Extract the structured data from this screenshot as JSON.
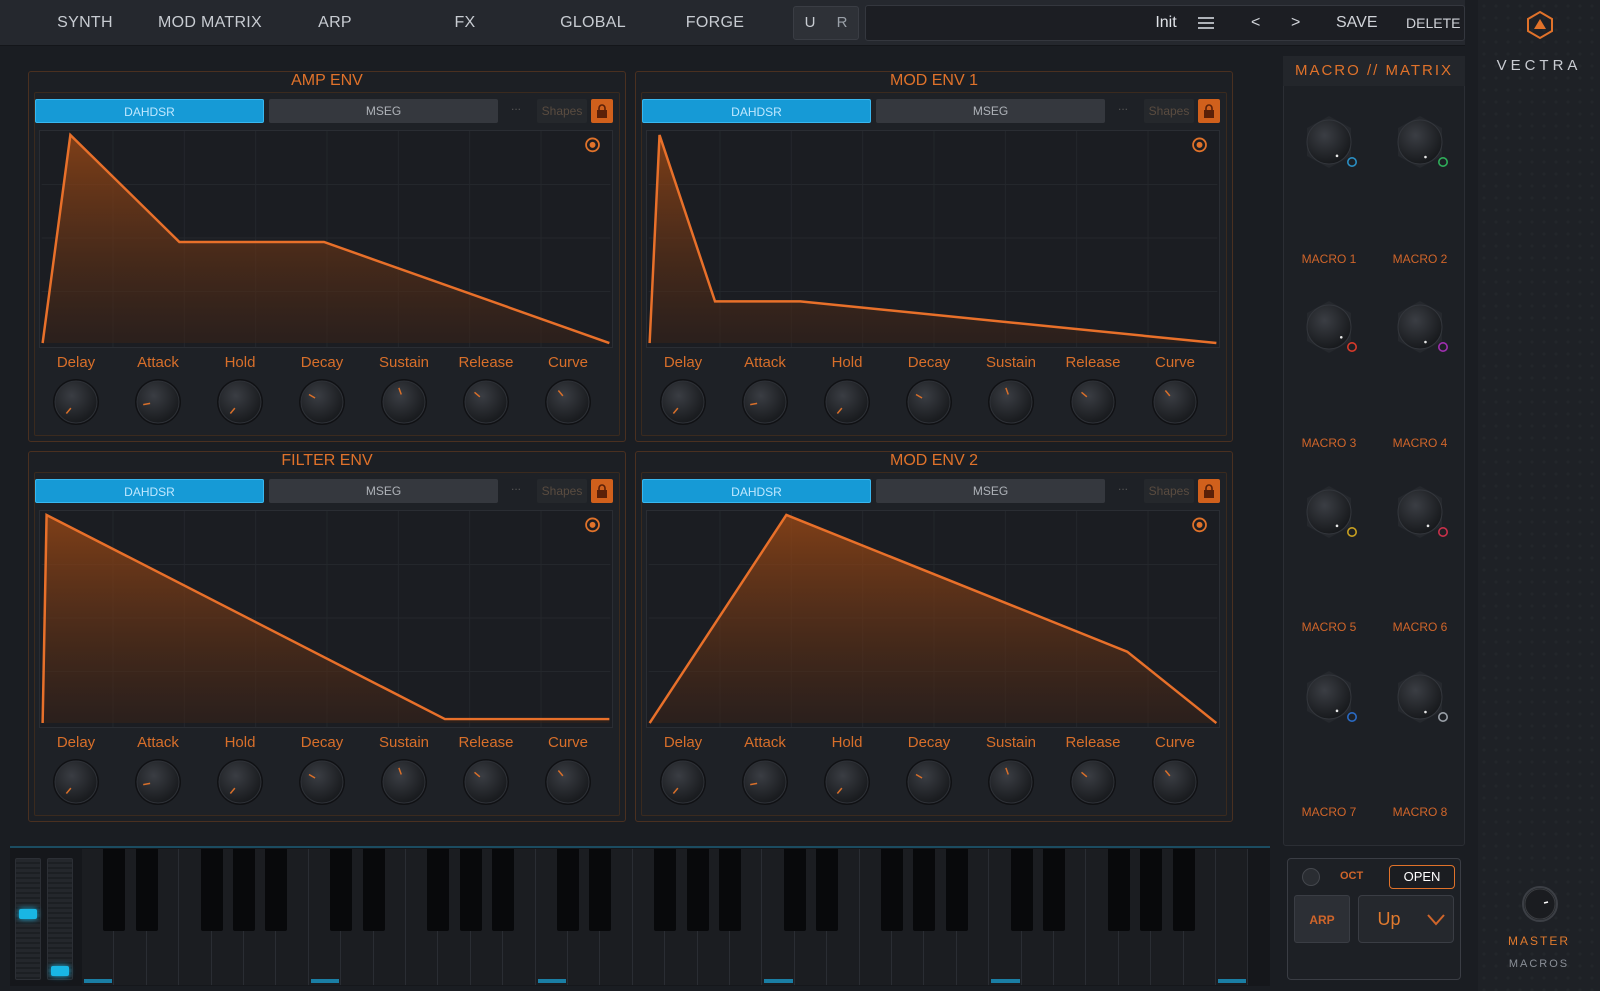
{
  "nav": {
    "tabs": [
      "SYNTH",
      "MOD MATRIX",
      "ARP",
      "FX",
      "GLOBAL",
      "FORGE"
    ],
    "undo": "U",
    "redo": "R"
  },
  "preset": {
    "name": "Init",
    "menu_icon": "hamburger-icon",
    "prev": "<",
    "next": ">",
    "save": "SAVE",
    "delete": "DELETE"
  },
  "brand": {
    "name": "VECTRA",
    "master": "MASTER",
    "macros": "MACROS"
  },
  "envelopes": {
    "amp": {
      "title": "AMP ENV",
      "mode_on": "DAHDSR",
      "mode_off": "MSEG",
      "dots": "...",
      "shapes": "Shapes"
    },
    "mod1": {
      "title": "MOD ENV 1",
      "mode_on": "DAHDSR",
      "mode_off": "MSEG",
      "dots": "...",
      "shapes": "Shapes"
    },
    "filter": {
      "title": "FILTER ENV",
      "mode_on": "DAHDSR",
      "mode_off": "MSEG",
      "dots": "...",
      "shapes": "Shapes"
    },
    "mod2": {
      "title": "MOD ENV 2",
      "mode_on": "DAHDSR",
      "mode_off": "MSEG",
      "dots": "...",
      "shapes": "Shapes"
    }
  },
  "params": [
    "Delay",
    "Attack",
    "Hold",
    "Decay",
    "Sustain",
    "Release",
    "Curve"
  ],
  "macro_matrix": {
    "title": "MACRO // MATRIX",
    "macros": [
      "MACRO 1",
      "MACRO 2",
      "MACRO 3",
      "MACRO 4",
      "MACRO 5",
      "MACRO 6",
      "MACRO 7",
      "MACRO 8"
    ],
    "ring_colors": [
      "#2a8fc4",
      "#2fae5a",
      "#d83a2a",
      "#a02fb0",
      "#c8a020",
      "#c8304a",
      "#2a6ac4",
      "#9aa0a8"
    ]
  },
  "arp": {
    "oct": "OCT",
    "open": "OPEN",
    "button": "ARP",
    "mode": "Up"
  },
  "colors": {
    "accent_orange": "#e0722a",
    "accent_blue": "#169ad6"
  }
}
